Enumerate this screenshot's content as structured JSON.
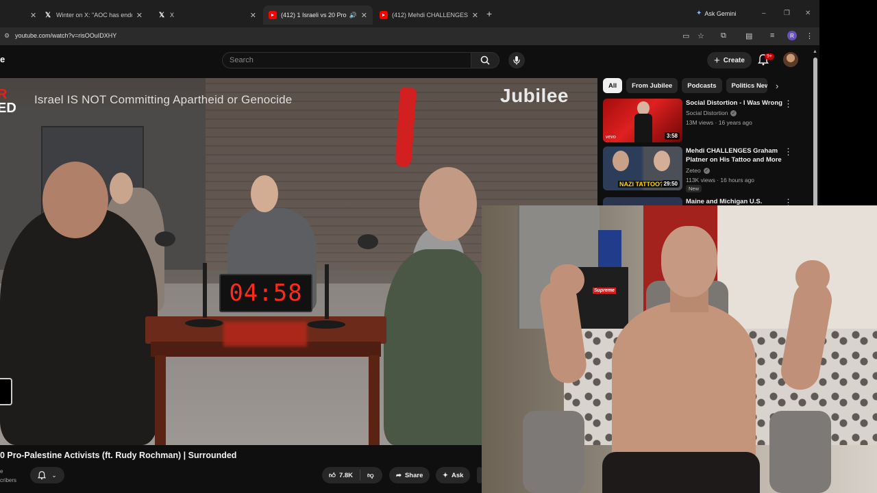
{
  "browser": {
    "tabs": [
      {
        "title": "Winter on X: \"AOC has endorse",
        "icon": "x-logo-icon",
        "active": false
      },
      {
        "title": "X",
        "icon": "x-logo-icon",
        "active": false
      },
      {
        "title": "(412) 1 Israeli vs 20 Pro-Pal",
        "icon": "youtube-icon",
        "active": true
      },
      {
        "title": "(412) Mehdi CHALLENGES Gra",
        "icon": "youtube-icon",
        "active": false
      }
    ],
    "gemini_label": "Ask Gemini",
    "url": "youtube.com/watch?v=risOOuIDXHY",
    "profile_initial": "R"
  },
  "youtube": {
    "logo_fragment": "e",
    "search_placeholder": "Search",
    "create_label": "Create",
    "notifications_badge": "9+",
    "video": {
      "overlay_brand": [
        "R",
        "ED"
      ],
      "overlay_title": "Israel IS NOT Committing Apartheid or Genocide",
      "watermark": "Jubilee",
      "timer_display": "04:58",
      "title": "0 Pro-Palestine Activists (ft. Rudy Rochman) | Surrounded",
      "subscribers_fragment": "cribers",
      "subscribers_dot": "e",
      "likes": "7.8K",
      "share_label": "Share",
      "ask_label": "Ask"
    },
    "chips": [
      "All",
      "From Jubilee",
      "Podcasts",
      "Politics New"
    ],
    "recommendations": [
      {
        "title": "Social Distortion - I Was Wrong",
        "channel": "Social Distortion",
        "views": "13M views",
        "age": "16 years ago",
        "duration": "3:58",
        "thumb_text": "vevo"
      },
      {
        "title": "Mehdi CHALLENGES Graham Platner on His Tattoo and More",
        "channel": "Zeteo",
        "views": "113K views",
        "age": "16 hours ago",
        "duration": "29:50",
        "thumb_text": "NAZI TATTOO?",
        "badge": "New"
      },
      {
        "title": "Maine and Michigan U.S.",
        "channel": "",
        "views": "",
        "age": ""
      }
    ]
  },
  "webcam": {
    "sticker_text": "Supreme"
  },
  "colors": {
    "youtube_red": "#ff0000",
    "timer_red": "#ff2a1a",
    "chrome_bg": "#1f1f1f"
  }
}
